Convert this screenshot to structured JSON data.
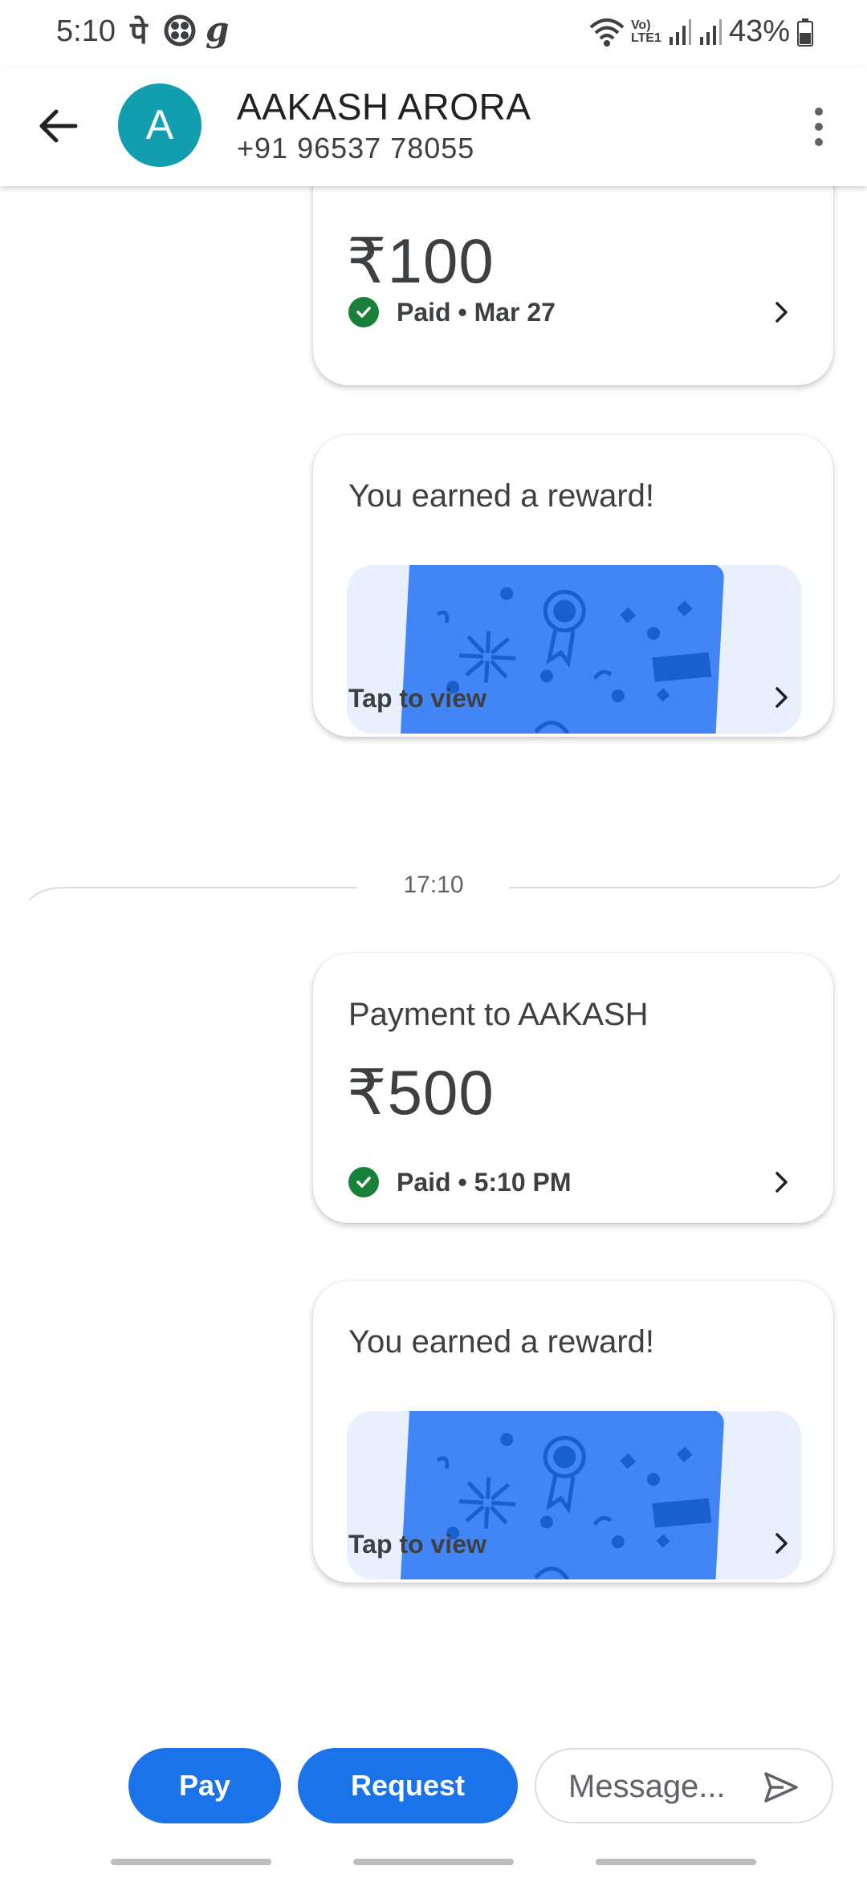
{
  "status_bar": {
    "time": "5:10",
    "notif_1": "पे",
    "notif_3": "g",
    "network": "Vo) LTE1",
    "battery": "43%"
  },
  "header": {
    "avatar_letter": "A",
    "name": "AAKASH ARORA",
    "phone": "+91 96537 78055"
  },
  "messages": [
    {
      "amount": "₹100",
      "status": "Paid • Mar 27"
    },
    {
      "title": "You earned a reward!",
      "action": "Tap to view"
    },
    {
      "separator": "17:10"
    },
    {
      "title": "Payment to AAKASH",
      "amount": "₹500",
      "status": "Paid • 5:10 PM"
    },
    {
      "title": "You earned a reward!",
      "action": "Tap to view"
    }
  ],
  "composer": {
    "pay_label": "Pay",
    "request_label": "Request",
    "message_placeholder": "Message..."
  },
  "colors": {
    "accent": "#1a73e8",
    "avatar": "#129eaf",
    "paid_check": "#188038",
    "reward_card": "#4285f4",
    "reward_bg": "#e8f0fe"
  }
}
